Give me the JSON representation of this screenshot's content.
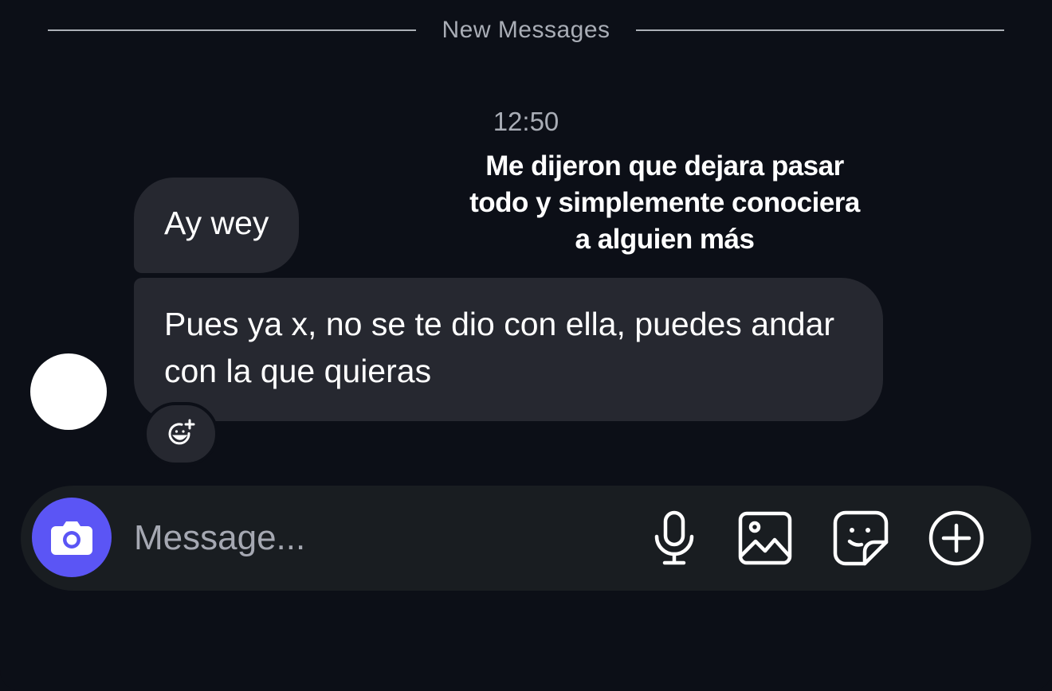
{
  "divider": {
    "label": "New Messages"
  },
  "timestamp": "12:50",
  "overlay_caption": {
    "lines": [
      "Me dijeron que dejara pasar",
      "todo y simplemente conociera",
      "a alguien más"
    ]
  },
  "messages": [
    {
      "text": "Ay wey"
    },
    {
      "text": "Pues ya x, no se te dio con ella, puedes andar con la que quieras"
    }
  ],
  "composer": {
    "placeholder": "Message...",
    "camera_icon": "camera-icon",
    "tools": [
      {
        "icon": "microphone-icon"
      },
      {
        "icon": "image-icon"
      },
      {
        "icon": "sticker-icon"
      },
      {
        "icon": "plus-circle-icon"
      }
    ]
  },
  "reaction_icon": "add-reaction-icon",
  "colors": {
    "background": "#0c0f17",
    "bubble": "#262830",
    "composer": "#191d21",
    "accent": "#5b55f5",
    "muted_text": "#a9adb6"
  }
}
